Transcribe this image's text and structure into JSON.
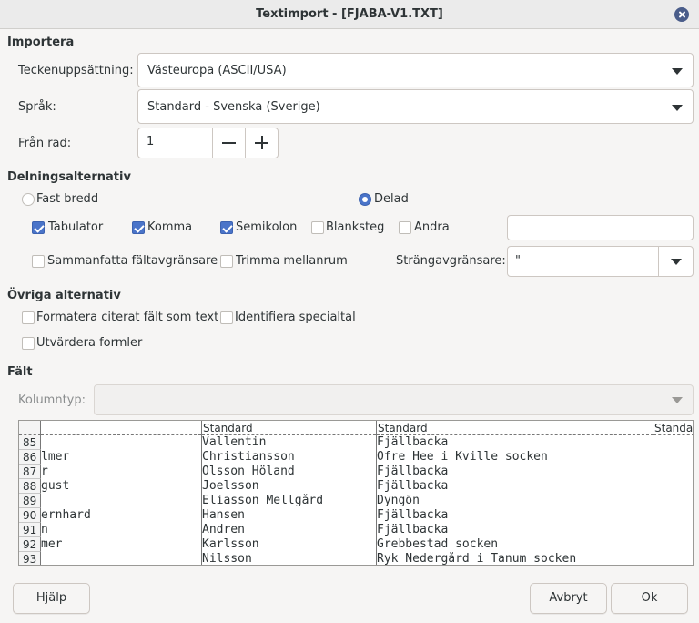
{
  "window": {
    "title": "Textimport - [FJABA-V1.TXT]"
  },
  "import": {
    "section": "Importera",
    "charset_label": "Teckenuppsättning:",
    "charset_value": "Västeuropa (ASCII/USA)",
    "language_label": "Språk:",
    "language_value": "Standard - Svenska (Sverige)",
    "from_row_label": "Från rad:",
    "from_row_value": "1"
  },
  "separator": {
    "section": "Delningsalternativ",
    "fixed_width": "Fast bredd",
    "separated": "Delad",
    "tab": "Tabulator",
    "comma": "Komma",
    "semicolon": "Semikolon",
    "space": "Blanksteg",
    "other": "Andra",
    "other_value": "",
    "merge": "Sammanfatta fältavgränsare",
    "trim": "Trimma mellanrum",
    "string_delim_label": "Strängavgränsare:",
    "string_delim_value": "\""
  },
  "other_options": {
    "section": "Övriga alternativ",
    "quoted_as_text": "Formatera citerat fält som text",
    "detect_special": "Identifiera specialtal",
    "evaluate_formulas": "Utvärdera formler"
  },
  "fields": {
    "section": "Fält",
    "column_type_label": "Kolumntyp:",
    "column_type_value": "",
    "headers": [
      "",
      "Standard",
      "Standard",
      "Standa"
    ],
    "rows": [
      {
        "num": "85",
        "c1": "",
        "c2": "Vallentin",
        "c3": "Fjällbacka"
      },
      {
        "num": "86",
        "c1": "lmer",
        "c2": "Christiansson",
        "c3": "Öfre Hee i Kville socken"
      },
      {
        "num": "87",
        "c1": "r",
        "c2": "Olsson Höland",
        "c3": "Fjällbacka"
      },
      {
        "num": "88",
        "c1": "gust",
        "c2": "Joelsson",
        "c3": "Fjällbacka"
      },
      {
        "num": "89",
        "c1": "",
        "c2": "Eliasson Mellgård",
        "c3": "Dyngön"
      },
      {
        "num": "90",
        "c1": "ernhard",
        "c2": "Hansen",
        "c3": "Fjällbacka"
      },
      {
        "num": "91",
        "c1": "n",
        "c2": "Andren",
        "c3": "Fjällbacka"
      },
      {
        "num": "92",
        "c1": "mer",
        "c2": "Karlsson",
        "c3": "Grebbestad socken"
      },
      {
        "num": "93",
        "c1": "",
        "c2": "Nilsson",
        "c3": "Ryk Nedergård i Tanum socken"
      }
    ]
  },
  "buttons": {
    "help": "Hjälp",
    "cancel": "Avbryt",
    "ok": "Ok"
  }
}
